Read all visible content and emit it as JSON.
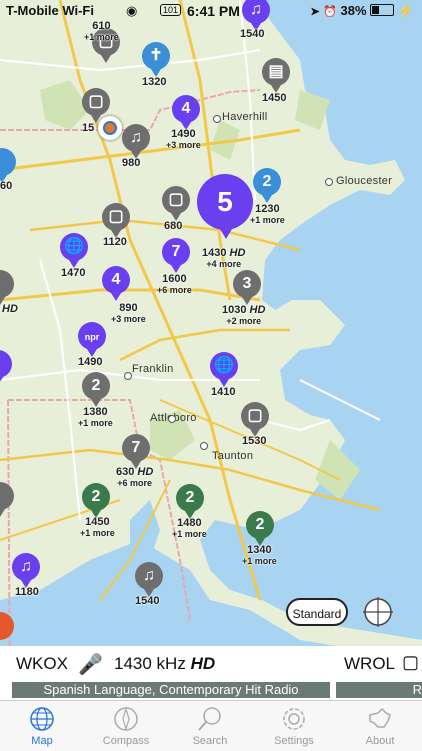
{
  "status_bar": {
    "carrier": "T-Mobile Wi-Fi",
    "highway_badge": "101",
    "time": "6:41 PM",
    "battery": "38%"
  },
  "places": {
    "haverhill": "Haverhill",
    "gloucester": "Gloucester",
    "franklin": "Franklin",
    "attleboro": "Attleboro",
    "taunton": "Taunton"
  },
  "markers": [
    {
      "count": "",
      "freq": "610",
      "more": "+1 more",
      "color": "gray",
      "icon": "chat-bubble-icon"
    },
    {
      "count": "",
      "freq": "1320",
      "more": "",
      "color": "blue",
      "icon": "cross-icon"
    },
    {
      "count": "",
      "freq": "1540",
      "more": "",
      "color": "purple",
      "icon": "guitar-icon"
    },
    {
      "count": "",
      "freq": "1450",
      "more": "",
      "color": "gray",
      "icon": "radio-icon"
    },
    {
      "count": "4",
      "freq": "1490",
      "more": "+3 more",
      "color": "purple",
      "icon": ""
    },
    {
      "count": "",
      "freq": "15",
      "more": "",
      "color": "gray",
      "icon": "chat-bubble-icon"
    },
    {
      "count": "",
      "freq": "980",
      "more": "",
      "color": "gray",
      "icon": "guitar-icon"
    },
    {
      "count": "2",
      "freq": "1230",
      "more": "+1 more",
      "color": "blue",
      "icon": ""
    },
    {
      "count": "5",
      "freq": "1430",
      "freq_suffix": "HD",
      "more": "+4 more",
      "color": "purple",
      "icon": ""
    },
    {
      "count": "",
      "freq": "680",
      "more": "",
      "color": "gray",
      "icon": "chat-bubble-icon"
    },
    {
      "count": "",
      "freq": "1120",
      "more": "",
      "color": "gray",
      "icon": "chat-bubble-icon"
    },
    {
      "count": "",
      "freq": "1470",
      "more": "",
      "color": "purple",
      "icon": "globe-music-icon"
    },
    {
      "count": "7",
      "freq": "1600",
      "more": "+6 more",
      "color": "purple",
      "icon": ""
    },
    {
      "count": "4",
      "freq": "890",
      "more": "+3 more",
      "color": "purple",
      "icon": ""
    },
    {
      "count": "3",
      "freq": "1030",
      "freq_suffix": "HD",
      "more": "+2 more",
      "color": "gray",
      "icon": ""
    },
    {
      "count": "",
      "freq": "1490",
      "more": "",
      "color": "purple",
      "icon": "npr-icon"
    },
    {
      "count": "",
      "freq": "1410",
      "more": "",
      "color": "purple",
      "icon": "globe-music-icon"
    },
    {
      "count": "2",
      "freq": "1380",
      "more": "+1 more",
      "color": "gray",
      "icon": ""
    },
    {
      "count": "",
      "freq": "1530",
      "more": "",
      "color": "gray",
      "icon": "chat-bubble-icon"
    },
    {
      "count": "7",
      "freq": "630",
      "freq_suffix": "HD",
      "more": "+6 more",
      "color": "gray",
      "icon": ""
    },
    {
      "count": "2",
      "freq": "1450",
      "more": "+1 more",
      "color": "green",
      "icon": ""
    },
    {
      "count": "2",
      "freq": "1480",
      "more": "+1 more",
      "color": "green",
      "icon": ""
    },
    {
      "count": "2",
      "freq": "1340",
      "more": "+1 more",
      "color": "green",
      "icon": ""
    },
    {
      "count": "",
      "freq": "1180",
      "more": "",
      "color": "purple",
      "icon": "guitar-icon"
    },
    {
      "count": "",
      "freq": "1540",
      "more": "",
      "color": "gray",
      "icon": "guitar-icon"
    },
    {
      "count": "",
      "freq": "60",
      "more": "",
      "color": "blue",
      "icon": ""
    },
    {
      "count": "",
      "freq": "HD",
      "more": "",
      "color": "gray",
      "icon": ""
    }
  ],
  "map_controls": {
    "standard_label": "Standard"
  },
  "station_cards": [
    {
      "call": "WKOX",
      "freq": "1430 kHz",
      "freq_suffix": "HD",
      "genre": "Spanish Language, Contemporary Hit Radio"
    },
    {
      "call": "WROL",
      "genre": "R"
    }
  ],
  "tabs": [
    {
      "label": "Map",
      "active": true
    },
    {
      "label": "Compass",
      "active": false
    },
    {
      "label": "Search",
      "active": false
    },
    {
      "label": "Settings",
      "active": false
    },
    {
      "label": "About",
      "active": false
    }
  ],
  "colors": {
    "accent": "#2a74d8",
    "purple_pin": "#6a3ff0",
    "gray_pin": "#6e6e6e",
    "green_pin": "#3b7a4a",
    "blue_pin": "#3a8fd8",
    "water": "#a8d4f2",
    "land": "#e8efd9"
  }
}
